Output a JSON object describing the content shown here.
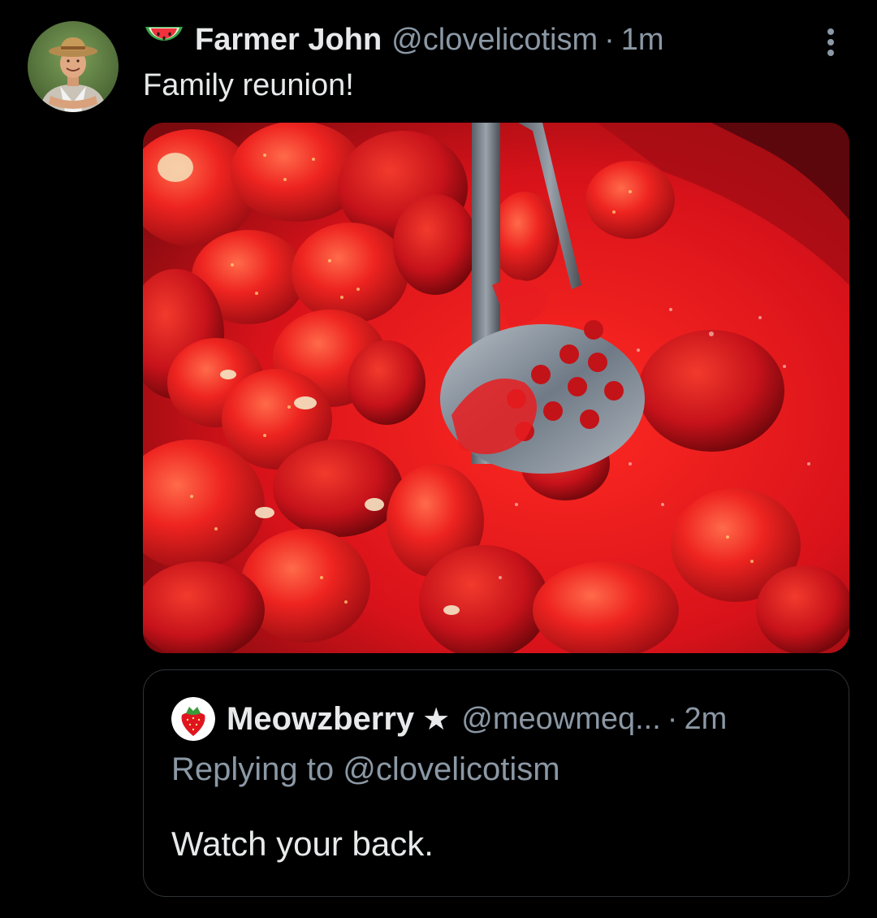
{
  "post": {
    "author": {
      "display_name": "Farmer John",
      "handle": "@clovelicotism",
      "name_emoji": "watermelon-icon",
      "avatar": "farmer-avatar"
    },
    "separator": "·",
    "time": "1m",
    "text": "Family reunion!",
    "media": {
      "subject": "strawberries-being-mashed-image"
    },
    "more_icon": "more-vertical-icon"
  },
  "quote": {
    "author": {
      "display_name": "Meowzberry",
      "star": "★",
      "handle": "@meowmeq...",
      "avatar": "strawberry-avatar"
    },
    "separator": "·",
    "time": "2m",
    "replying_to": "Replying to @clovelicotism",
    "text": "Watch your back."
  },
  "colors": {
    "background": "#000000",
    "primary_text": "#e7e9ea",
    "secondary_text": "#8b98a5",
    "border": "#2f3336",
    "strawberry_red": "#e0141e"
  }
}
